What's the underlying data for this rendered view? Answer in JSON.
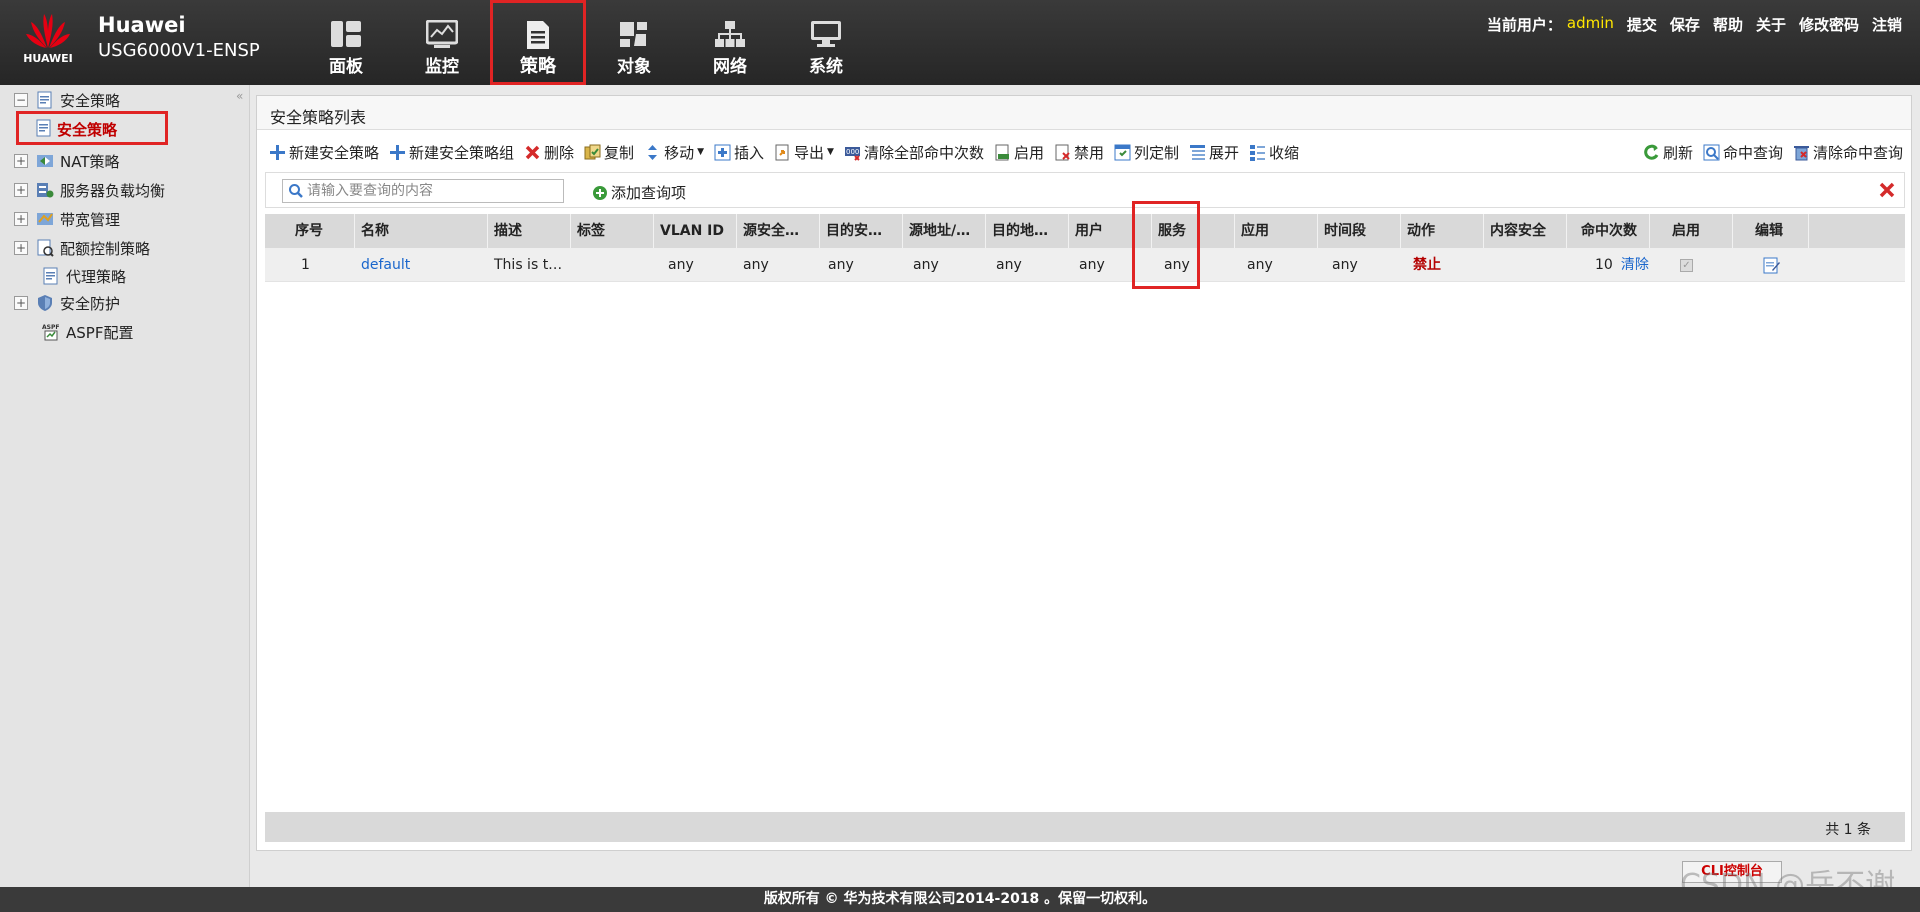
{
  "header": {
    "logo_text": "HUAWEI",
    "brand_line1": "Huawei",
    "brand_line2": "USG6000V1-ENSP",
    "nav": [
      {
        "label": "面板",
        "icon": "dashboard-icon"
      },
      {
        "label": "监控",
        "icon": "monitor-icon"
      },
      {
        "label": "策略",
        "icon": "policy-document-icon",
        "active": true
      },
      {
        "label": "对象",
        "icon": "object-icon"
      },
      {
        "label": "网络",
        "icon": "network-icon"
      },
      {
        "label": "系统",
        "icon": "system-icon"
      }
    ],
    "current_user_label": "当前用户：",
    "current_user": "admin",
    "links": [
      "提交",
      "保存",
      "帮助",
      "关于",
      "修改密码",
      "注销"
    ]
  },
  "sidebar": {
    "items": [
      {
        "label": "安全策略",
        "expanded": true
      },
      {
        "label": "安全策略",
        "selected": true
      },
      {
        "label": "NAT策略"
      },
      {
        "label": "服务器负载均衡"
      },
      {
        "label": "带宽管理"
      },
      {
        "label": "配额控制策略"
      },
      {
        "label": "代理策略"
      },
      {
        "label": "安全防护"
      },
      {
        "label": "ASPF配置"
      }
    ]
  },
  "main": {
    "title": "安全策略列表",
    "toolbar": [
      "新建安全策略",
      "新建安全策略组",
      "删除",
      "复制",
      "移动",
      "插入",
      "导出",
      "清除全部命中次数",
      "启用",
      "禁用",
      "列定制",
      "展开",
      "收缩"
    ],
    "toolbar_right": [
      "刷新",
      "命中查询",
      "清除命中查询"
    ],
    "search_placeholder": "请输入要查询的内容",
    "add_query": "添加查询项",
    "columns": [
      "序号",
      "名称",
      "描述",
      "标签",
      "VLAN ID",
      "源安全…",
      "目的安…",
      "源地址/…",
      "目的地…",
      "用户",
      "服务",
      "应用",
      "时间段",
      "动作",
      "内容安全",
      "命中次数",
      "启用",
      "编辑"
    ],
    "rows": [
      {
        "seq": "1",
        "name": "default",
        "desc": "This is t…",
        "tag": "",
        "vlan": "any",
        "src_zone": "any",
        "dst_zone": "any",
        "src_addr": "any",
        "dst_addr": "any",
        "user": "any",
        "service": "any",
        "app": "any",
        "time": "any",
        "action": "禁止",
        "content_security": "",
        "hits": "10",
        "clear": "清除",
        "enabled": true
      }
    ],
    "total": "共 1 条"
  },
  "console_button": "CLI控制台",
  "watermark": "CSDN @岳不谢",
  "footer": "版权所有 © 华为技术有限公司2014-2018 。保留一切权利。"
}
